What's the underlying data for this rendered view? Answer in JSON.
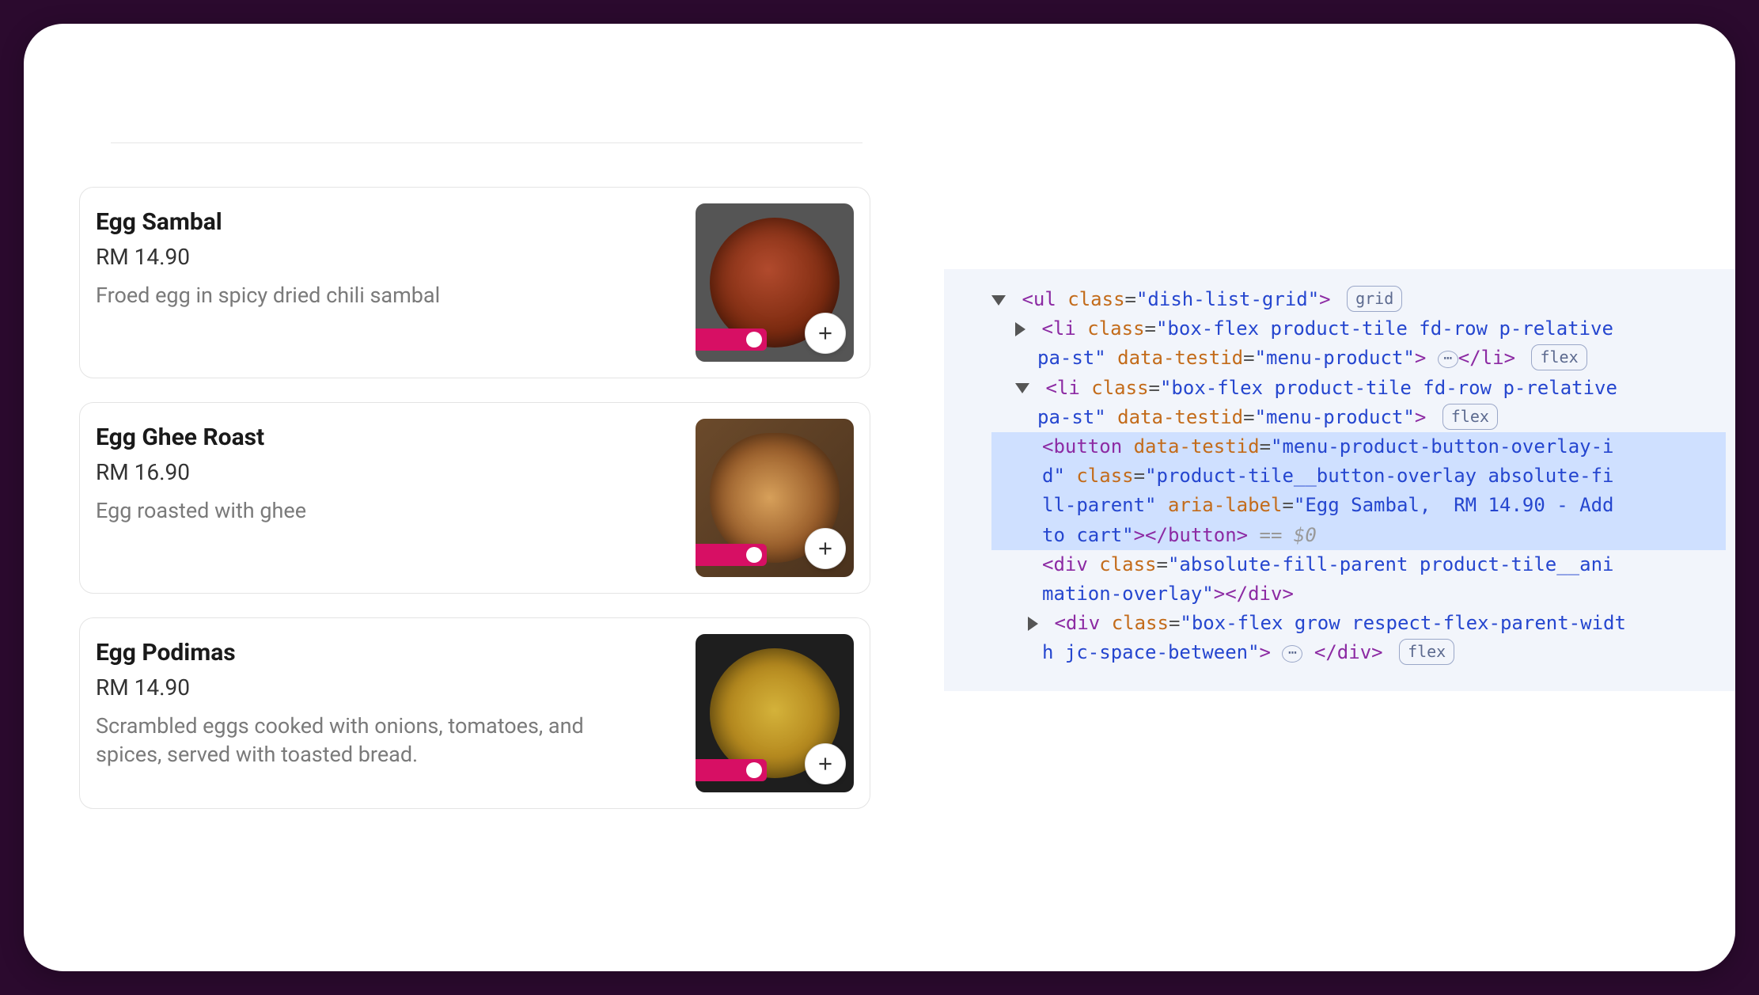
{
  "dishes": [
    {
      "name": "Egg Sambal",
      "price": "RM 14.90",
      "description": "Froed egg in spicy dried chili sambal"
    },
    {
      "name": "Egg Ghee Roast",
      "price": "RM 16.90",
      "description": "Egg roasted with ghee"
    },
    {
      "name": "Egg Podimas",
      "price": "RM 14.90",
      "description": "Scrambled eggs cooked with onions, tomatoes, and spices, served with toasted bread."
    }
  ],
  "devtools": {
    "pill_grid": "grid",
    "pill_flex": "flex",
    "ul_class": "dish-list-grid",
    "li_class": "box-flex product-tile fd-row p-relative pa-st",
    "li_testid": "menu-product",
    "btn_testid": "menu-product-button-overlay-id",
    "btn_class": "product-tile__button-overlay absolute-fill-parent",
    "btn_aria": "Egg Sambal,  RM 14.90 - Add to cart",
    "div1_class": "absolute-fill-parent product-tile__animation-overlay",
    "div2_class": "box-flex grow respect-flex-parent-width jc-space-between",
    "eq_marker": "== $0"
  }
}
